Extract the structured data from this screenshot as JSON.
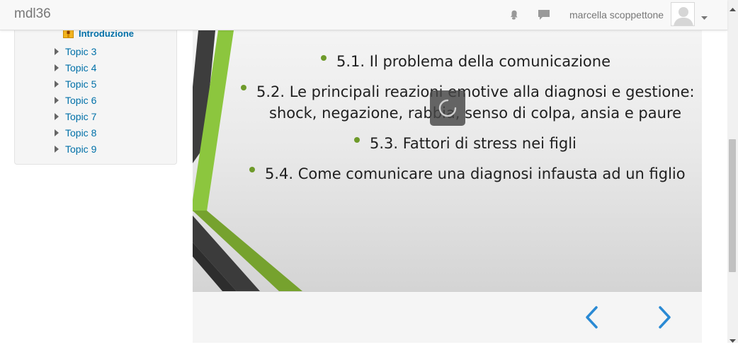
{
  "navbar": {
    "brand": "mdl36",
    "user_name": "marcella scoppettone",
    "icons": [
      "bell-icon",
      "message-icon",
      "avatar",
      "caret-down-icon"
    ]
  },
  "sidebar": {
    "intro_label": "Introduzione",
    "intro_icon": "package-icon",
    "items": [
      {
        "label": "Topic 3"
      },
      {
        "label": "Topic 4"
      },
      {
        "label": "Topic 5"
      },
      {
        "label": "Topic 6"
      },
      {
        "label": "Topic 7"
      },
      {
        "label": "Topic 8"
      },
      {
        "label": "Topic 9"
      }
    ]
  },
  "slide": {
    "lines": [
      "5.1. Il problema della comunicazione",
      "5.2. Le principali reazioni emotive alla diagnosi e gestione:",
      "shock, negazione, rabbia, senso di colpa, ansia e paure",
      "5.3. Fattori di stress nei figli",
      "5.4. Come comunicare una diagnosi infausta ad un figlio"
    ],
    "accent_color": "#6e9a2a",
    "loading": true
  },
  "viewer_nav": {
    "prev_icon": "chevron-left-icon",
    "next_icon": "chevron-right-icon",
    "arrow_color": "#2a8ad4"
  }
}
